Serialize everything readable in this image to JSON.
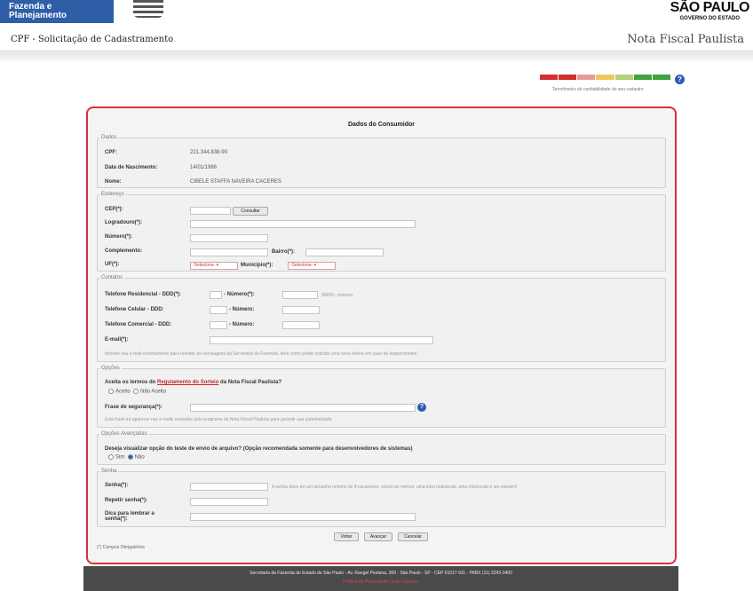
{
  "header": {
    "brand_line1": "Fazenda e",
    "brand_line2": "Planejamento",
    "sp_logo_line1": "SÃO PAULO",
    "sp_logo_line2": "GOVERNO DO ESTADO",
    "page_title": "CPF - Solicitação de Cadastramento",
    "product_title": "Nota Fiscal Paulista"
  },
  "meter": {
    "colors": [
      "#d32f2f",
      "#d32f2f",
      "#e89a9a",
      "#f0c75e",
      "#b6d07c",
      "#3fa340",
      "#3fa340"
    ],
    "help": "?",
    "caption": "Termômetro de confiabilidade do seu cadastro"
  },
  "form": {
    "title": "Dados do Consumidor",
    "dados": {
      "legend": "Dados",
      "cpf_label": "CPF:",
      "cpf_value": "221.344.838-90",
      "nascimento_label": "Data de Nascimento:",
      "nascimento_value": "14/01/1986",
      "nome_label": "Nome:",
      "nome_value": "CIBELE STAFFA NAVEIRA CACERES"
    },
    "endereco": {
      "legend": "Endereço",
      "cep_label": "CEP(*):",
      "consultar_label": "Consultar",
      "logradouro_label": "Logradouro(*):",
      "numero_label": "Número(*):",
      "complemento_label": "Complemento:",
      "bairro_label": "Bairro(*):",
      "uf_label": "UF(*):",
      "uf_selected": "-Selecione-",
      "municipio_label": "Município(*):",
      "municipio_selected": "-Selecione-"
    },
    "contatos": {
      "legend": "Contatos",
      "residencial_label": "Telefone Residencial - DDD(*):",
      "numero_label": "- Número(*):",
      "numero_hint": "99999 - número",
      "celular_label": "Telefone Celular - DDD:",
      "numero2_label": "- Número:",
      "comercial_label": "Telefone Comercial - DDD:",
      "numero3_label": "- Número:",
      "email_label": "E-mail(*):",
      "email_hint": "Informe seu e-mail corretamente para receber as mensagens da Secretaria da Fazenda, bem como poder solicitar uma nova senha em caso de esquecimento."
    },
    "opcoes": {
      "legend": "Opções",
      "aceita_prefix": "Aceita os termos do",
      "aceita_link": "Regulamento do Sorteio",
      "aceita_suffix": "da Nota Fiscal Paulista?",
      "option_nao": "Aceito",
      "option_sim": "Não Aceito",
      "frase_label": "Frase de segurança(*):",
      "frase_hint": "Esta frase irá aparecer nas e-mails enviados pelo programa da Nota Fiscal Paulista para garantir sua autenticidade."
    },
    "avancadas": {
      "legend": "Opções Avançadas",
      "question": "Deseja visualizar opção do teste de envio de arquivo? (Opção recomendada somente para desenvolvedores de sistemas)",
      "option_sim": "Sim",
      "option_nao": "Não"
    },
    "senha": {
      "legend": "Senha",
      "senha_label": "Senha(*):",
      "senha_hint": "A senha deve ter um tamanho mínimo de 8 caracteres, sendo ao menos, uma letra maiúscula, uma minúscula e um número!",
      "repetir_label": "Repetir senha(*):",
      "dica_label": "Dica para lembrar a",
      "dica_label2": "senha(*):"
    },
    "buttons": {
      "voltar": "Voltar",
      "avancar": "Avançar",
      "cancelar": "Cancelar"
    },
    "required_note": "(*) Campos Obrigatórios"
  },
  "footer": {
    "text": "Secretaria da Fazenda do Estado de São Paulo - Av. Rangel Pestana, 300 - São Paulo - SP - CEP 01017-911 - PABX (11) 3243-3400",
    "links": "Política de Privacidade | Fale Conosco"
  }
}
